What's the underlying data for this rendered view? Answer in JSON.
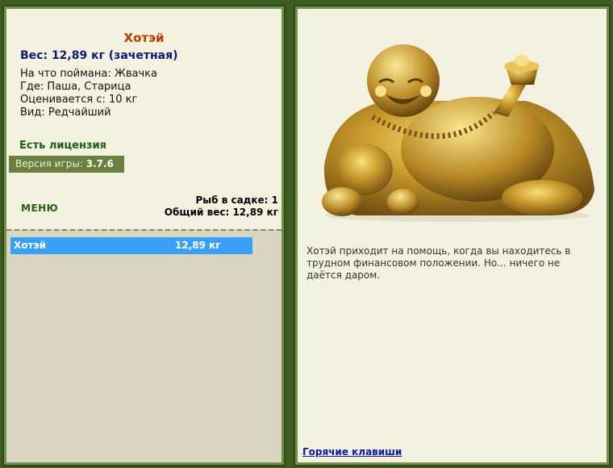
{
  "fish": {
    "name": "Хотэй",
    "weight_line": "Вес: 12,89 кг (зачетная)",
    "caught_on": "На что поймана: Жвачка",
    "where": "Где: Паша, Старица",
    "valued_from": "Оценивается с: 10 кг",
    "kind": "Вид: Редчайший"
  },
  "license": "Есть лицензия",
  "version": {
    "label": "Версия игры:",
    "value": "3.7.6"
  },
  "menu_label": "МЕНЮ",
  "stats": {
    "fish_in_cage": "Рыб в садке: 1",
    "total_weight": "Общий вес: 12,89 кг"
  },
  "catch_list": [
    {
      "name": "Хотэй",
      "weight": "12,89 кг"
    }
  ],
  "description": "Хотэй приходит на помощь, когда вы находитесь в трудном финансовом положении. Но... ничего не даётся даром.",
  "hotkeys_label": "Горячие клавиши",
  "colors": {
    "accent_blue": "#3aa0f5",
    "panel_bg": "#f3f1e0",
    "frame_green": "#3d5c23"
  }
}
